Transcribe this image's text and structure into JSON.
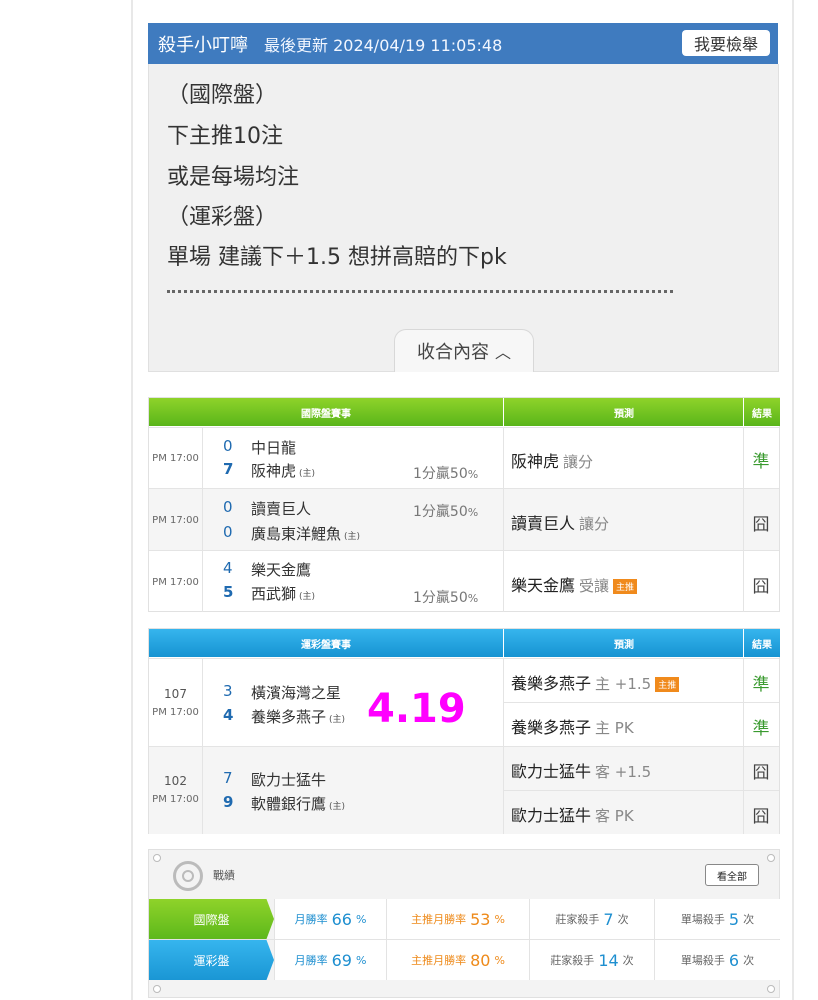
{
  "post": {
    "author": "殺手小叮嚀",
    "updated": "最後更新 2024/04/19 11:05:48",
    "report_label": "我要檢舉",
    "lines": [
      "（國際盤）",
      "下主推10注",
      "或是每場均注",
      "（運彩盤）",
      "單場 建議下＋1.5 想拼高賠的下pk"
    ],
    "collapse_label": "收合內容"
  },
  "intl": {
    "header": {
      "match": "國際盤賽事",
      "predict": "預測",
      "result": "結果"
    },
    "rows": [
      {
        "time": "PM 17:00",
        "away_score": "0",
        "away": "中日龍",
        "home_score": "7",
        "home": "阪神虎",
        "host_mark": "(主)",
        "odds": "1分贏50",
        "pct": "%",
        "pick": "阪神虎",
        "pick_type": "讓分",
        "tag": "",
        "result": "準"
      },
      {
        "time": "PM 17:00",
        "away_score": "0",
        "away": "讀賣巨人",
        "home_score": "0",
        "home": "廣島東洋鯉魚",
        "host_mark": "(主)",
        "odds": "1分贏50",
        "pct": "%",
        "pick": "讀賣巨人",
        "pick_type": "讓分",
        "tag": "",
        "result": "囧"
      },
      {
        "time": "PM 17:00",
        "away_score": "4",
        "away": "樂天金鷹",
        "home_score": "5",
        "home": "西武獅",
        "host_mark": "(主)",
        "odds": "1分贏50",
        "pct": "%",
        "pick": "樂天金鷹",
        "pick_type": "受讓",
        "tag": "主推",
        "result": "囧"
      }
    ]
  },
  "lottery": {
    "header": {
      "match": "運彩盤賽事",
      "predict": "預測",
      "result": "結果"
    },
    "date_overlay": "4.19",
    "rows": [
      {
        "code": "107",
        "time": "PM 17:00",
        "away_score": "3",
        "away": "橫濱海灣之星",
        "home_score": "4",
        "home": "養樂多燕子",
        "host_mark": "(主)",
        "picks": [
          {
            "team": "養樂多燕子",
            "type": "主 +1.5",
            "tag": "主推",
            "result": "準"
          },
          {
            "team": "養樂多燕子",
            "type": "主 PK",
            "tag": "",
            "result": "準"
          }
        ]
      },
      {
        "code": "102",
        "time": "PM 17:00",
        "away_score": "7",
        "away": "歐力士猛牛",
        "home_score": "9",
        "home": "軟體銀行鷹",
        "host_mark": "(主)",
        "picks": [
          {
            "team": "歐力士猛牛",
            "type": "客 +1.5",
            "tag": "",
            "result": "囧"
          },
          {
            "team": "歐力士猛牛",
            "type": "客 PK",
            "tag": "",
            "result": "囧"
          }
        ]
      }
    ]
  },
  "stats": {
    "title": "戰績",
    "all_label": "看全部",
    "rows": [
      {
        "label": "國際盤",
        "month_label": "月勝率",
        "month_value": "66",
        "month_unit": "%",
        "top_label": "主推月勝率",
        "top_value": "53",
        "top_unit": "%",
        "house_label": "莊家殺手",
        "house_value": "7",
        "house_unit": "次",
        "single_label": "單場殺手",
        "single_value": "5",
        "single_unit": "次"
      },
      {
        "label": "運彩盤",
        "month_label": "月勝率",
        "month_value": "69",
        "month_unit": "%",
        "top_label": "主推月勝率",
        "top_value": "80",
        "top_unit": "%",
        "house_label": "莊家殺手",
        "house_value": "14",
        "house_unit": "次",
        "single_label": "單場殺手",
        "single_value": "6",
        "single_unit": "次"
      }
    ]
  }
}
